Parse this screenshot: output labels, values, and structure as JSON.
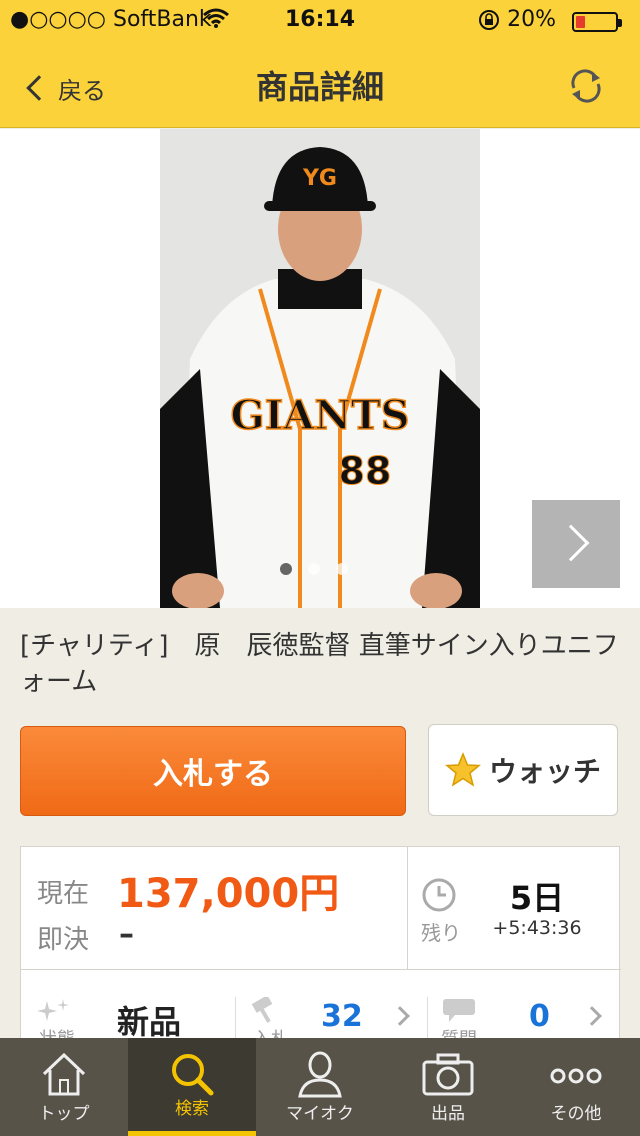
{
  "status": {
    "carrier": "●○○○○ SoftBank",
    "time": "16:14",
    "battery": "20%"
  },
  "nav": {
    "back_label": "戻る",
    "title": "商品詳細"
  },
  "item": {
    "title": "[チャリティ]　原　辰徳監督 直筆サイン入りユニフォーム",
    "image_count": 3,
    "active_image": 1
  },
  "actions": {
    "bid_label": "入札する",
    "watch_label": "ウォッチ"
  },
  "info": {
    "current_label": "現在",
    "current_price": "137,000円",
    "buyout_label": "即決",
    "buyout_price": "–",
    "remaining_label": "残り",
    "remaining_days": "5日",
    "remaining_time": "+5:43:36",
    "condition_label": "状態",
    "condition_value": "新品",
    "bids_label": "入札",
    "bids_count": "32",
    "questions_label": "質問",
    "questions_count": "0"
  },
  "tabs": [
    {
      "label": "トップ",
      "icon": "home-icon"
    },
    {
      "label": "検索",
      "icon": "search-icon"
    },
    {
      "label": "マイオク",
      "icon": "person-icon"
    },
    {
      "label": "出品",
      "icon": "camera-icon"
    },
    {
      "label": "その他",
      "icon": "more-icon"
    }
  ],
  "colors": {
    "header": "#fbd23a",
    "bid_button": "#f47a26",
    "price": "#f05a14",
    "count": "#1a73d8",
    "tab_active": "#f5c400"
  }
}
